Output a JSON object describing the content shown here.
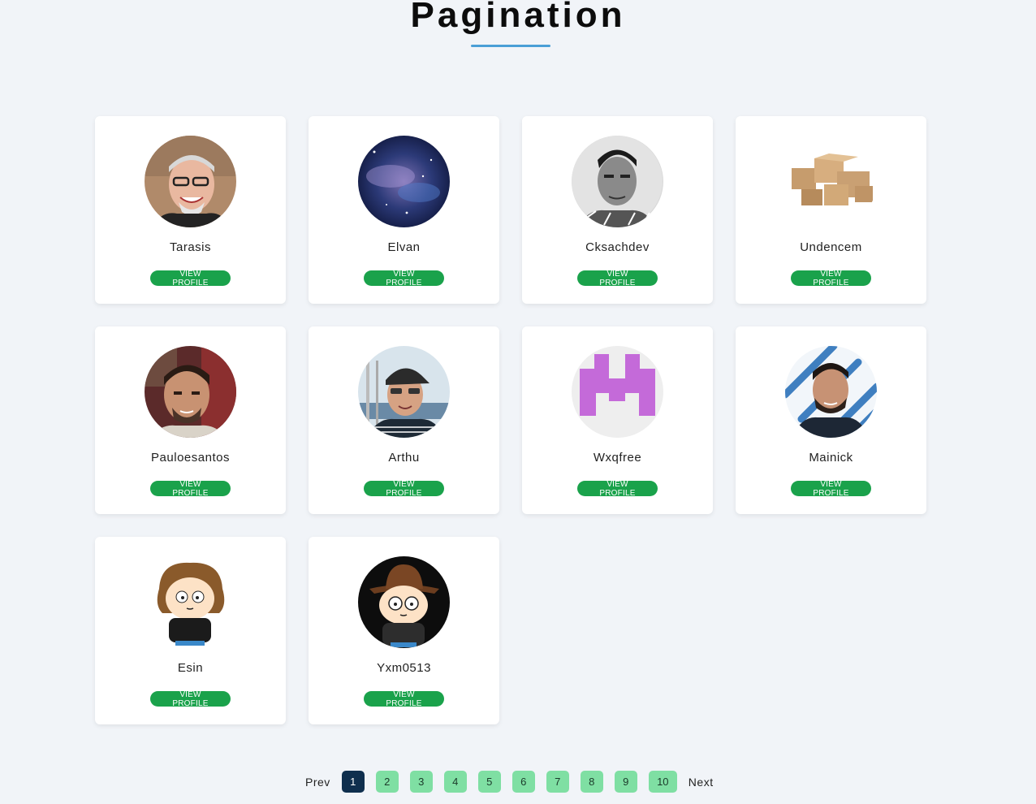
{
  "page": {
    "title": "Pagination"
  },
  "colors": {
    "accent_underline": "#4a9fd6",
    "button_green": "#1aa24b",
    "page_active": "#0f2f4e",
    "page_inactive": "#7fdfa3",
    "background": "#f1f4f8"
  },
  "profiles": [
    {
      "name": "Tarasis",
      "button": "VIEW PROFILE",
      "avatar": "photo-older-man-glasses"
    },
    {
      "name": "Elvan",
      "button": "VIEW PROFILE",
      "avatar": "galaxy-image"
    },
    {
      "name": "Cksachdev",
      "button": "VIEW PROFILE",
      "avatar": "photo-man-grayscale"
    },
    {
      "name": "Undencem",
      "button": "VIEW PROFILE",
      "avatar": "cardboard-boxes-image"
    },
    {
      "name": "Pauloesantos",
      "button": "VIEW PROFILE",
      "avatar": "photo-man-beard"
    },
    {
      "name": "Arthu",
      "button": "VIEW PROFILE",
      "avatar": "photo-man-cap-sunglasses"
    },
    {
      "name": "Wxqfree",
      "button": "VIEW PROFILE",
      "avatar": "pixel-identicon"
    },
    {
      "name": "Mainick",
      "button": "VIEW PROFILE",
      "avatar": "photo-man-blue-pattern"
    },
    {
      "name": "Esin",
      "button": "VIEW PROFILE",
      "avatar": "cartoon-character-curly-hair"
    },
    {
      "name": "Yxm0513",
      "button": "VIEW PROFILE",
      "avatar": "cartoon-character-hat-glasses"
    }
  ],
  "pagination": {
    "prev": "Prev",
    "next": "Next",
    "pages": [
      "1",
      "2",
      "3",
      "4",
      "5",
      "6",
      "7",
      "8",
      "9",
      "10"
    ],
    "current_page": 1
  }
}
